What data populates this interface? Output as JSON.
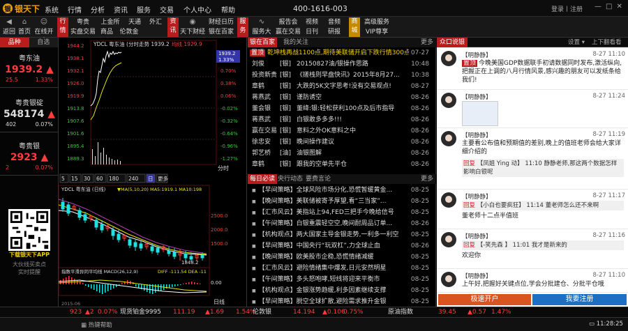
{
  "app": {
    "logo_text": "银天下",
    "hotline": "400-1616-003",
    "login": "登录丨注册"
  },
  "menu": [
    "系统",
    "行情",
    "分析",
    "资讯",
    "服务",
    "交易",
    "个人中心",
    "帮助"
  ],
  "toolbar": {
    "back": "返回",
    "home": "首页",
    "open_account": "在线开户",
    "section_quote": "行情",
    "section_info": "资讯",
    "section_service": "服务",
    "section_mall": "商城",
    "cells": [
      "粤贵",
      "上金所",
      "天通",
      "实盘交易",
      "商品",
      "伦敦金",
      "外汇",
      "天下财经",
      "财经日历",
      "银在百家",
      "服务大厅",
      "报告会",
      "视频",
      "赢在交易",
      "日刊",
      "音频",
      "高级服务",
      "研报",
      "VIP尊享"
    ]
  },
  "left": {
    "tabs": [
      "品种",
      "自选"
    ],
    "quotes": [
      {
        "name": "粤东油",
        "price": "1939.2",
        "arrow": "▲",
        "change": "25.5",
        "pct": "1.33%"
      },
      {
        "name": "粤贵银碇",
        "price": "548174",
        "arrow": "▲",
        "change": "402",
        "pct": "0.07%"
      },
      {
        "name": "粤贵银",
        "price": "2923",
        "arrow": "▲",
        "change": "2",
        "pct": "0.07%"
      }
    ],
    "qr_caption": "下载银天下APP",
    "qr_sub1": "大伙线买卖点",
    "qr_sub2": "实时提醒"
  },
  "chart_top": {
    "title": "YDCL 粤东油 (分时走势 1939.2",
    "dot": "均线 1929.9",
    "cur_price": "1939.2",
    "cur_pct": "1.33%",
    "y_ticks": [
      "1944.2",
      "1938.1",
      "1932.1",
      "1926.0",
      "1919.9",
      "1913.8",
      "1907.6",
      "1901.6",
      "1895.4",
      "1889.3"
    ],
    "pct_ticks": [
      "1.33%",
      "1.02%",
      "0.70%",
      "0.38%",
      "0.06%",
      "-0.02%",
      "-0.32%",
      "-0.64%",
      "-0.96%",
      "-1.27%"
    ],
    "x_label": "分时"
  },
  "chart_bottom": {
    "tabs": [
      "5",
      "15",
      "30",
      "60",
      "180",
      "240",
      "日",
      "更多"
    ],
    "title": "YDCL 粤东油 (日线)",
    "ma": "▼MA(5,10,20)  MA5:1919.1  MA10:198",
    "y_ticks": [
      "2500.0",
      "2000.0",
      "1500.0"
    ],
    "low_label": "1848.2",
    "macd_title": "指数平滑异同平均线 MACD(26,12,9)",
    "macd_val": "DIFF -111.54  DEA -11",
    "macd_tick": "0.00",
    "x_label": "日线",
    "date": "2015-06"
  },
  "news": {
    "tabs1": [
      "银在百家",
      "我的关注"
    ],
    "more": "更多",
    "items1": [
      {
        "tag": "置顶",
        "src": "",
        "title": "乾坤栈再战1100点,期待美联储开启下跌行情300点",
        "time": "07-27",
        "top": true
      },
      {
        "tag": "",
        "src": "刘俊",
        "cat": "[银]",
        "title": "20150827油/银操作思路",
        "time": "10:48"
      },
      {
        "tag": "",
        "src": "投资新贵",
        "cat": "[银]",
        "title": "《搓栈则早盘快讯》2015年8月27...",
        "time": "10:38"
      },
      {
        "tag": "",
        "src": "章鹤",
        "cat": "[银]",
        "title": "大跌的5K文字思考!没有交易观点!",
        "time": "08-27"
      },
      {
        "tag": "",
        "src": "蒋燕武",
        "cat": "[银]",
        "title": "谨防诱空",
        "time": "08-26"
      },
      {
        "tag": "",
        "src": "董会银",
        "cat": "[银]",
        "title": "董绛:银:轻松获利100点及后市指导",
        "time": "08-26"
      },
      {
        "tag": "",
        "src": "蒋燕武",
        "cat": "[银]",
        "title": "白银敢多多多!!!",
        "time": "08-26"
      },
      {
        "tag": "",
        "src": "赢在交易",
        "cat": "[银]",
        "title": "意料之外OK意料之中",
        "time": "08-26"
      },
      {
        "tag": "",
        "src": "徐忠安",
        "cat": "[银]",
        "title": "晚间操作建议",
        "time": "08-26"
      },
      {
        "tag": "",
        "src": "郭艺桥",
        "cat": "[油]",
        "title": "油银图解",
        "time": "08-26"
      },
      {
        "tag": "",
        "src": "章鹤",
        "cat": "[银]",
        "title": "跟我的空单先平仓",
        "time": "08-26"
      }
    ],
    "tabs2": [
      "每日必读",
      "央行动态",
      "要费言论"
    ],
    "items2": [
      {
        "title": "【早间策略】全球风险市场分化,恐慌暂缓黄金...",
        "time": "08-25"
      },
      {
        "title": "【晚间策略】美联储被寄予厚望,看“三当家”...",
        "time": "08-25"
      },
      {
        "title": "【汇市风云】美指站上94,FED三把手今晚给信号",
        "time": "08-25"
      },
      {
        "title": "【午间策略】白银重震轻空空,晚间耐周品订单...",
        "time": "08-26"
      },
      {
        "title": "【机构观点】两大国家主导金银走势,一利多一利空",
        "time": "08-25"
      },
      {
        "title": "【早间策略】中国央行“玩双杠”,力全球止血",
        "time": "08-26"
      },
      {
        "title": "【晚间策略】欧美股市企稳,恐慌情绪减缓",
        "time": "08-25"
      },
      {
        "title": "【汇市风云】避险情绪集中爆发,日元安然明星",
        "time": "08-25"
      },
      {
        "title": "【午间策略】多头怒咆哮,短线将迎来平衡市",
        "time": "08-25"
      },
      {
        "title": "【机构观点】金银涨势趋缓,利多因素继续支撑",
        "time": "08-25"
      },
      {
        "title": "【早间策略】脱空全球扩散,避险需求推升金银",
        "time": "08-25"
      }
    ]
  },
  "chat": {
    "tab": "众口说银",
    "settings": "设置 ▾",
    "paste": "上下翻看看",
    "messages": [
      {
        "name": "【明静静】",
        "time": "8-27 11:10",
        "text_tag": "置顶",
        "text": "今晚美国GDP数据联手初请数据同时发布,激活纵向,把握正在上调的八月行情风景,感兴趣的朋友可以发纸条给我们!"
      },
      {
        "name": "【明静静】",
        "time": "8-27 11:24",
        "text": ""
      },
      {
        "name": "【明静静】",
        "time": "8-27 11:19",
        "text": "主要看公布值和预期值的差别,晚上的值班老师会给大家详细介绍的",
        "reply_tag": "回复",
        "reply": "【凤姐 Ying 动】 11:10  静静老师,那这两个数据怎样影响白银呢"
      },
      {
        "name": "【明静静】",
        "time": "8-27 11:17",
        "text": "董老师十二点半值班",
        "reply_tag": "回复",
        "reply": "【小白也要疯狂】 11:14  董老师怎么还不来啊"
      },
      {
        "name": "【明静静】",
        "time": "8-27 11:16",
        "text": "欢迎你",
        "reply_tag": "回复",
        "reply": "【-笑先森  】 11:01  我才是新来的"
      },
      {
        "name": "【明静静】",
        "time": "8-27 11:10",
        "text": "上午好,把握好关键点位,学会分批建仓、分批平仓哦"
      }
    ],
    "btn_open": "极速开户",
    "btn_register": "我要注册"
  },
  "ticker": [
    "923",
    "▲2",
    "0.07%",
    "现货铂金9995",
    "111.19",
    "▲1.69",
    "1.54%",
    "伦敦银",
    "14.194",
    "▲0.106",
    "0.75%",
    "原油指数",
    "39.45",
    "▲0.57",
    "1.47%"
  ],
  "status": {
    "help": "热键帮助",
    "time": "11:28:25"
  }
}
